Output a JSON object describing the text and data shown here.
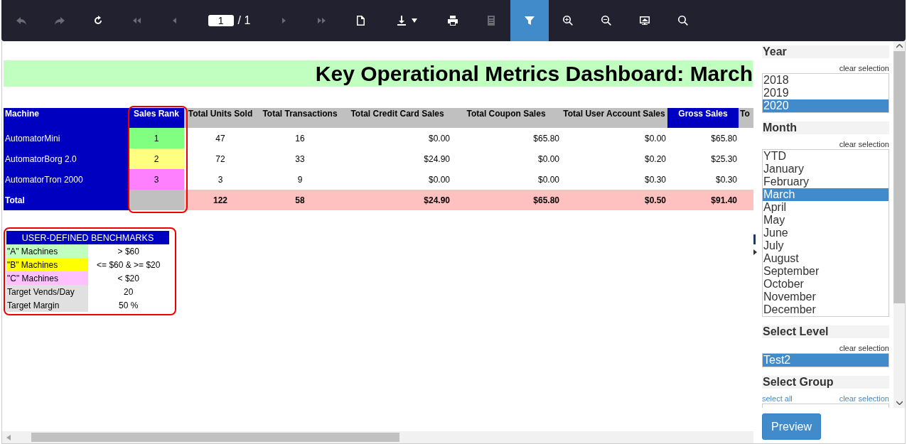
{
  "toolbar": {
    "items": [
      {
        "kind": "back",
        "disabled": true,
        "selected": false
      },
      {
        "kind": "forward",
        "disabled": true,
        "selected": false
      },
      {
        "kind": "refresh",
        "disabled": false,
        "selected": false
      },
      {
        "kind": "first",
        "disabled": true,
        "selected": false
      },
      {
        "kind": "prev",
        "disabled": true,
        "selected": false
      },
      {
        "kind": "page",
        "value": "1",
        "total": "/ 1"
      },
      {
        "kind": "next",
        "disabled": true,
        "selected": false
      },
      {
        "kind": "last",
        "disabled": true,
        "selected": false
      },
      {
        "kind": "new-page",
        "disabled": false,
        "selected": false
      },
      {
        "kind": "download",
        "disabled": false,
        "selected": false
      },
      {
        "kind": "print",
        "disabled": false,
        "selected": false
      },
      {
        "kind": "document",
        "disabled": true,
        "selected": false
      },
      {
        "kind": "filter",
        "disabled": false,
        "selected": true
      },
      {
        "kind": "zoom-in",
        "disabled": false,
        "selected": false
      },
      {
        "kind": "zoom-out",
        "disabled": false,
        "selected": false
      },
      {
        "kind": "present",
        "disabled": false,
        "selected": false
      },
      {
        "kind": "search",
        "disabled": false,
        "selected": false
      }
    ]
  },
  "report": {
    "title": "Key Operational Metrics Dashboard: March",
    "table": {
      "columns": [
        {
          "label": "Machine",
          "color": "#0000c0"
        },
        {
          "label": "Sales Rank",
          "color": "#0000c0"
        },
        {
          "label": "Total Units Sold",
          "color": "#c0c0c0"
        },
        {
          "label": "Total Transactions",
          "color": "#c0c0c0"
        },
        {
          "label": "Total Credit Card Sales",
          "color": "#c0c0c0"
        },
        {
          "label": "Total Coupon Sales",
          "color": "#c0c0c0"
        },
        {
          "label": "Total User Account Sales",
          "color": "#c0c0c0"
        },
        {
          "label": "Gross Sales",
          "color": "#0000c0"
        },
        {
          "label": "To",
          "color": "#c0c0c0"
        }
      ],
      "rows": [
        {
          "color": "#80ff80",
          "cells": [
            "AutomatorMini",
            "1",
            "47",
            "16",
            "$0.00",
            "$65.80",
            "$0.00",
            "$65.80"
          ]
        },
        {
          "color": "#ffff80",
          "cells": [
            "AutomatorBorg 2.0",
            "2",
            "72",
            "33",
            "$24.90",
            "$0.00",
            "$0.20",
            "$25.30"
          ]
        },
        {
          "color": "#ff80ff",
          "cells": [
            "AutomatorTron 2000",
            "3",
            "3",
            "9",
            "$0.00",
            "$0.00",
            "$0.30",
            "$0.30"
          ]
        }
      ],
      "total": {
        "cells": [
          "Total",
          "",
          "122",
          "58",
          "$24.90",
          "$65.80",
          "$0.50",
          "$91.40"
        ]
      }
    },
    "benchmarks": {
      "title": "USER-DEFINED BENCHMARKS",
      "rows": [
        {
          "label": "\"A\" Machines",
          "value": "> $60",
          "color": "#c0ffc0"
        },
        {
          "label": "\"B\" Machines",
          "value": "<= $60 & >= $20",
          "color": "#ffff00"
        },
        {
          "label": "\"C\" Machines",
          "value": "< $20",
          "color": "#ffc0ff"
        },
        {
          "label": "Target Vends/Day",
          "value": "20",
          "color": "#e0e0e0"
        },
        {
          "label": "Target Margin",
          "value": "50 %",
          "color": "#e0e0e0"
        }
      ]
    }
  },
  "filters": {
    "sections": [
      {
        "title": "Year",
        "clear": "clear selection",
        "items": [
          {
            "label": "2018",
            "selected": false
          },
          {
            "label": "2019",
            "selected": false
          },
          {
            "label": "2020",
            "selected": true
          }
        ]
      },
      {
        "title": "Month",
        "clear": "clear selection",
        "items": [
          {
            "label": "YTD",
            "selected": false
          },
          {
            "label": "January",
            "selected": false
          },
          {
            "label": "February",
            "selected": false
          },
          {
            "label": "March",
            "selected": true
          },
          {
            "label": "April",
            "selected": false
          },
          {
            "label": "May",
            "selected": false
          },
          {
            "label": "June",
            "selected": false
          },
          {
            "label": "July",
            "selected": false
          },
          {
            "label": "August",
            "selected": false
          },
          {
            "label": "September",
            "selected": false
          },
          {
            "label": "October",
            "selected": false
          },
          {
            "label": "November",
            "selected": false
          },
          {
            "label": "December",
            "selected": false
          }
        ]
      },
      {
        "title": "Select Level",
        "clear": "clear selection",
        "items": [
          {
            "label": "Test2",
            "selected": true
          }
        ]
      },
      {
        "title": "Select Group",
        "select_all": "select all",
        "clear": "clear selection"
      }
    ],
    "button": "Preview"
  }
}
